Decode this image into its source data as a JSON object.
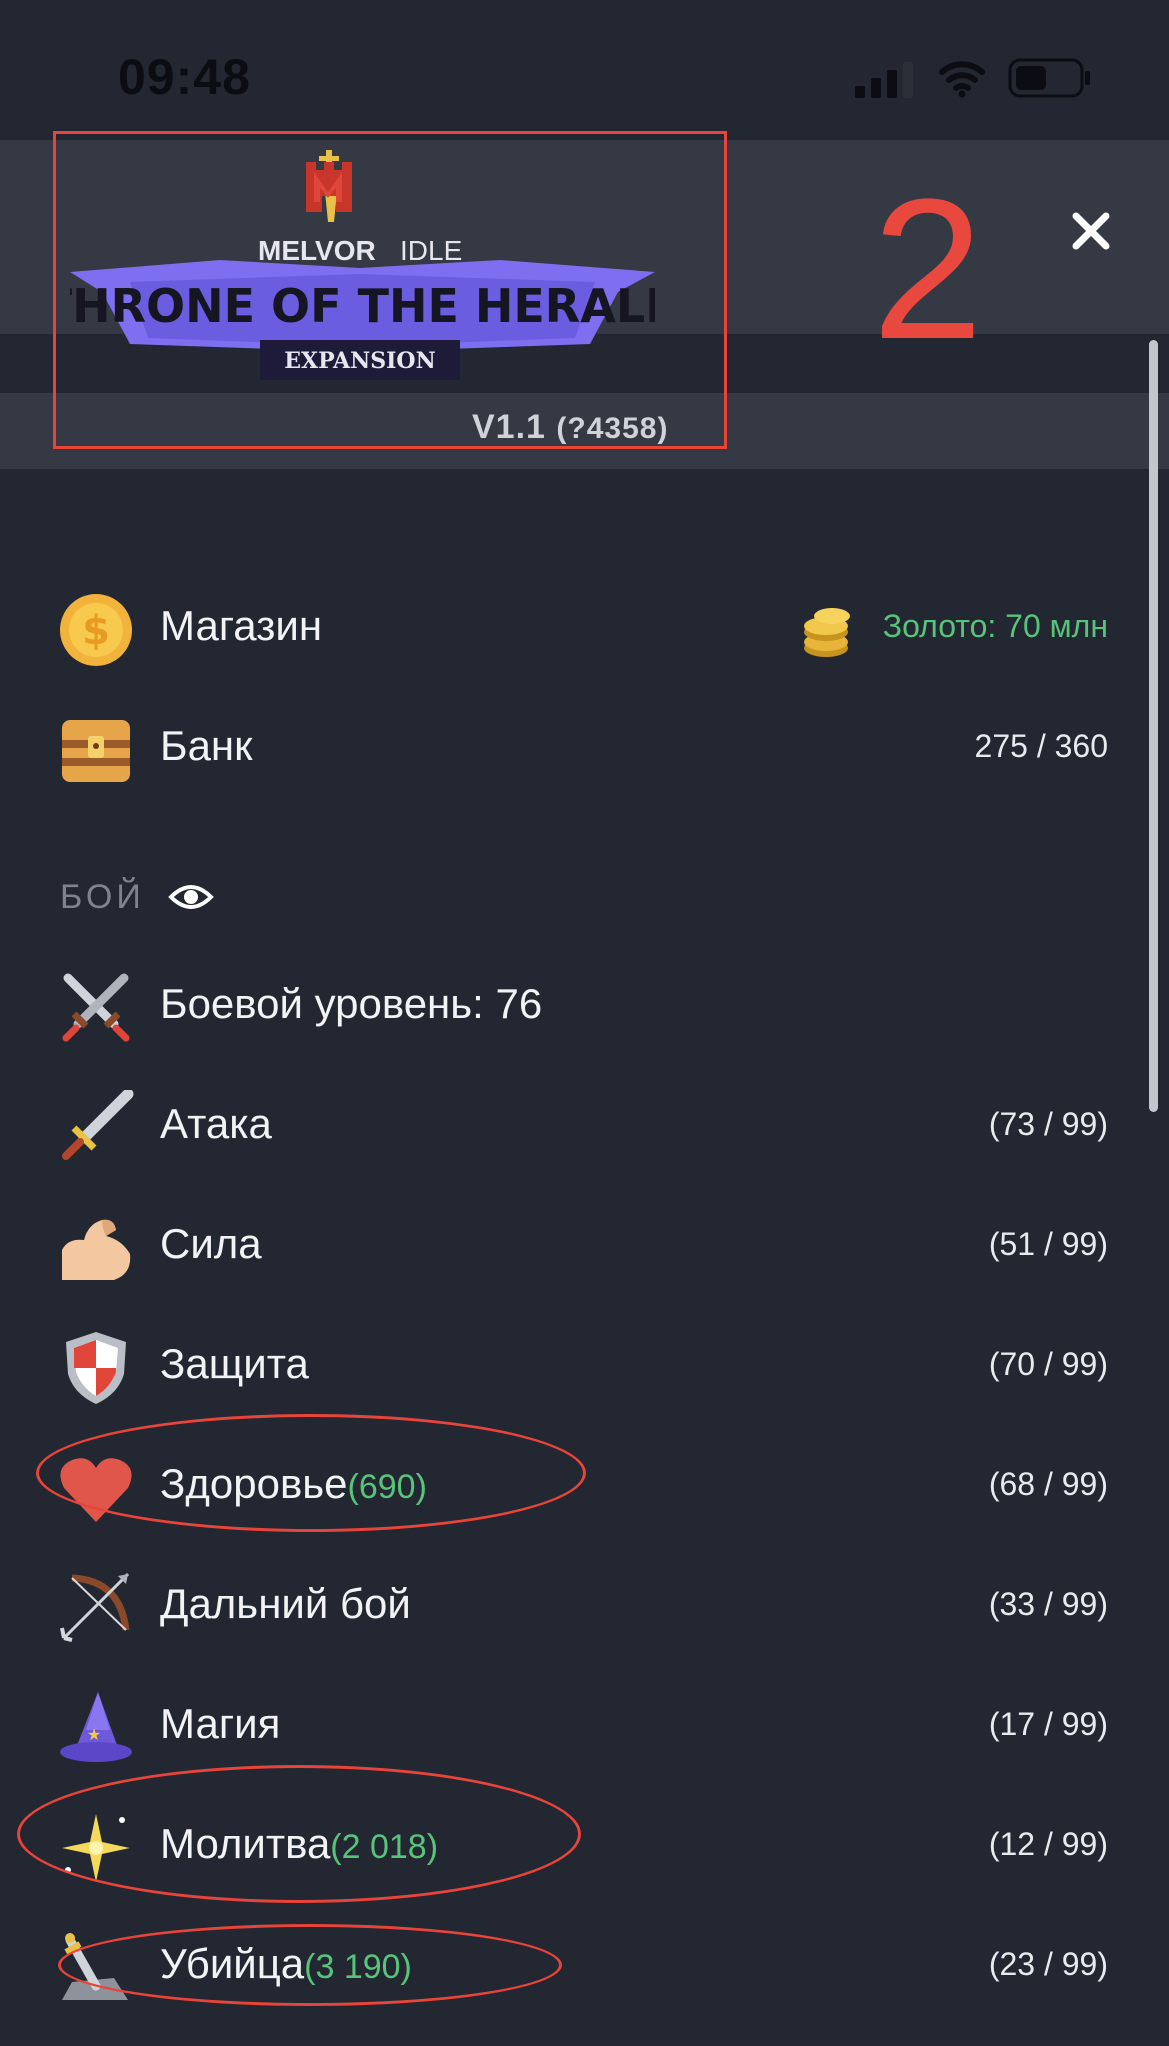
{
  "status": {
    "time": "09:48"
  },
  "header": {
    "logo_title": "THRONE OF THE HERALD",
    "logo_brand_a": "MELVOR",
    "logo_brand_b": "IDLE",
    "logo_of_the": "OF THE",
    "logo_badge": "EXPANSION",
    "version": "V1.1",
    "build": "(?4358)",
    "annotation_number": "2"
  },
  "menu": {
    "shop": {
      "label": "Магазин",
      "gold": "Золото: 70 млн"
    },
    "bank": {
      "label": "Банк",
      "count": "275 / 360"
    }
  },
  "combat": {
    "section_label": "БОЙ",
    "items": [
      {
        "label": "Боевой уровень: 76",
        "xp": "",
        "level": "",
        "icon": "crossed-swords-icon"
      },
      {
        "label": "Атака",
        "xp": "",
        "level": "(73 / 99)",
        "icon": "sword-icon"
      },
      {
        "label": "Сила",
        "xp": "",
        "level": "(51 / 99)",
        "icon": "flexed-arm-icon"
      },
      {
        "label": "Защита",
        "xp": "",
        "level": "(70 / 99)",
        "icon": "shield-icon"
      },
      {
        "label": "Здоровье",
        "xp": "(690)",
        "level": "(68 / 99)",
        "icon": "heart-icon"
      },
      {
        "label": "Дальний бой",
        "xp": "",
        "level": "(33 / 99)",
        "icon": "bow-icon"
      },
      {
        "label": "Магия",
        "xp": "",
        "level": "(17 / 99)",
        "icon": "wizard-hat-icon"
      },
      {
        "label": "Молитва",
        "xp": "(2 018)",
        "level": "(12 / 99)",
        "icon": "sparkle-icon"
      },
      {
        "label": "Убийца",
        "xp": "(3 190)",
        "level": "(23 / 99)",
        "icon": "slayer-sword-icon"
      }
    ]
  },
  "colors": {
    "background": "#222732",
    "bar": "#343944",
    "green": "#58c47a",
    "annotation_red": "#e8443a"
  }
}
